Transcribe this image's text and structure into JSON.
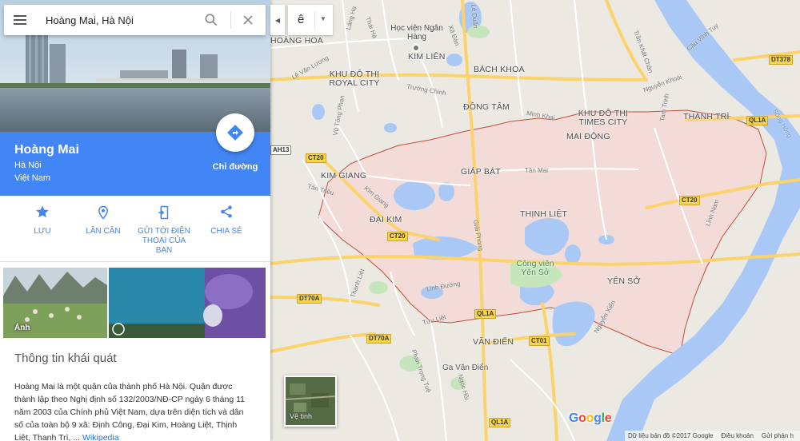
{
  "search": {
    "value": "Hoàng Mai, Hà Nội",
    "placeholder": ""
  },
  "ime": {
    "char": "ê",
    "collapse_arrow": "◀",
    "dropdown_arrow": "▼"
  },
  "place": {
    "title": "Hoàng Mai",
    "city": "Hà Nội",
    "country": "Việt Nam",
    "directions_label": "Chỉ đường"
  },
  "actions": [
    {
      "label": "LƯU",
      "icon": "star-icon"
    },
    {
      "label": "LÂN CẬN",
      "icon": "nearby-icon"
    },
    {
      "label": "GỬI TỚI ĐIỆN THOẠI CỦA BẠN",
      "icon": "send-to-phone-icon"
    },
    {
      "label": "CHIA SẺ",
      "icon": "share-icon"
    }
  ],
  "photos": {
    "label": "Ảnh"
  },
  "overview": {
    "title": "Thông tin khái quát",
    "text": "Hoàng Mai là một quận của thành phố Hà Nội. Quận được thành lập theo Nghị định số 132/2003/NĐ-CP ngày 6 tháng 11 năm 2003 của Chính phủ Việt Nam, dựa trên diện tích và dân số của toàn bộ 9 xã: Định Công, Đại Kim, Hoàng Liệt, Thịnh Liệt, Thanh Trì, ...",
    "link": "Wikipedia"
  },
  "satellite": {
    "label": "Vệ tinh"
  },
  "footer": {
    "data": "Dữ liệu bản đồ ©2017 Google",
    "terms": "Điều khoản",
    "feedback": "Gửi phản h"
  },
  "logo": {
    "G": "G",
    "o1": "o",
    "o2": "o",
    "g": "g",
    "l": "l",
    "e": "e"
  },
  "map": {
    "areas": [
      "HOÀNG HOA",
      "KHU ĐÔ THỊ ROYAL CITY",
      "KIM LIÊN",
      "BÁCH KHOA",
      "ĐỒNG TÂM",
      "KHU ĐÔ THỊ TIMES CITY",
      "MAI ĐỘNG",
      "THANH TRÌ",
      "GIÁP BÁT",
      "KIM GIANG",
      "ĐẠI KIM",
      "THỊNH LIỆT",
      "YÊN SỞ",
      "VĂN ĐIỂN"
    ],
    "pois": [
      "Học viện Ngân Hàng",
      "Công viên Yên Sở",
      "Ga Văn Điển"
    ],
    "streets": [
      "Láng Hạ",
      "Thái Hà",
      "Lê Văn Lương",
      "Trường Chinh",
      "Lê Duẩn",
      "Xã Đàn",
      "Trần Khát Chân",
      "Nguyễn Khoái",
      "Minh Khai",
      "Tân Mai",
      "Kim Giang",
      "Tân Triều",
      "Giải Phóng",
      "Linh Đường",
      "Nguyễn Xiển",
      "Vũ Tông Phan",
      "Lĩnh Nam",
      "Tứu Liệt",
      "Thanh Liệt",
      "Tam Trinh",
      "Cầu Vĩnh Tuy",
      "Sông Hồng",
      "Phan Trọng Tuệ",
      "Ngọc Hồi"
    ],
    "road_shields": [
      "CT20",
      "CT20",
      "CT20",
      "QL1A",
      "QL1A",
      "QL1A",
      "DT378",
      "DT70A",
      "DT70A",
      "CT01",
      "AH13"
    ]
  },
  "colors": {
    "accent": "#4285f4",
    "district_fill": "#f3d9d5",
    "district_border": "#c0392b",
    "river": "#a9c8f6",
    "road": "#fbd36a"
  }
}
